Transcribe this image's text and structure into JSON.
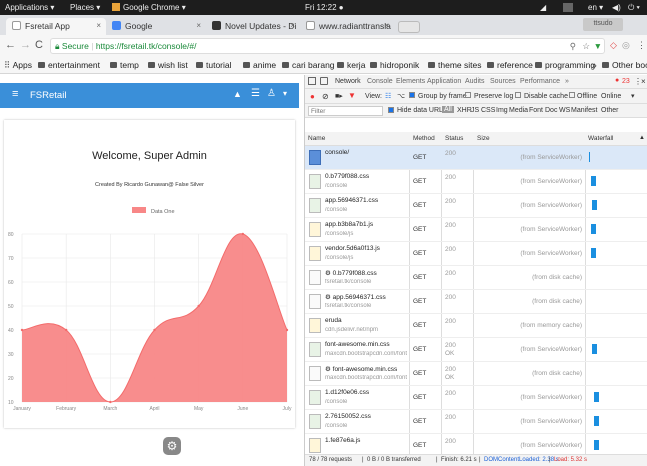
{
  "topbar": {
    "applications": "Applications ▾",
    "places": "Places ▾",
    "chrome": "Google Chrome ▾",
    "clock": "Fri 12:22 ●",
    "lang": "en ▾"
  },
  "tabs": [
    {
      "label": "Fsretail App",
      "close": "×",
      "color": "#3a8fd9"
    },
    {
      "label": "Google",
      "close": "×",
      "color": "#ffffff"
    },
    {
      "label": "Novel Updates - Di",
      "close": "×",
      "color": "#333333"
    },
    {
      "label": "www.radianttransla",
      "close": "×",
      "color": "#ffffff"
    }
  ],
  "profile": "ttsudo",
  "address": {
    "secure": "Secure",
    "url": "https://fsretail.tk/console/#/"
  },
  "bookmarks": [
    "Apps",
    "entertainment",
    "temp",
    "wish list",
    "tutorial",
    "anime",
    "cari barang",
    "kerja",
    "hidroponik",
    "theme sites",
    "reference",
    "programming"
  ],
  "bookmarks_more": "»",
  "bookmarks_other": "Other bookmarks",
  "app": {
    "title": "FSRetail",
    "welcome": "Welcome, Super Admin",
    "credit": "Created By Ricardo Gunawan@ False Silver"
  },
  "chart_data": {
    "type": "area",
    "title": "",
    "legend": "Data One",
    "categories": [
      "January",
      "February",
      "March",
      "April",
      "May",
      "June",
      "July"
    ],
    "values": [
      40,
      40,
      10,
      40,
      50,
      80,
      40
    ],
    "yticks": [
      10,
      20,
      30,
      40,
      50,
      60,
      70,
      80
    ],
    "ylim": [
      10,
      80
    ],
    "color": "#f88787"
  },
  "devtools": {
    "tabs": [
      "Network",
      "Console",
      "Elements",
      "Application",
      "Audits",
      "Sources",
      "Performance",
      "»"
    ],
    "errors": "23",
    "toolbar": {
      "view": "View:",
      "group": "Group by frame",
      "preserve": "Preserve log",
      "disable": "Disable cache",
      "offline": "Offline",
      "online": "Online"
    },
    "filter": {
      "placeholder": "Filter",
      "hide": "Hide data URLs",
      "types": [
        "All",
        "XHR",
        "JS",
        "CSS",
        "Img",
        "Media",
        "Font",
        "Doc",
        "WS",
        "Manifest",
        "Other"
      ]
    },
    "columns": {
      "name": "Name",
      "method": "Method",
      "status": "Status",
      "size": "Size",
      "waterfall": "Waterfall"
    },
    "rows": [
      {
        "name": "console/",
        "path": "",
        "method": "GET",
        "status": "200",
        "size": "(from ServiceWorker)"
      },
      {
        "name": "0.b779f088.css",
        "path": "/console",
        "method": "GET",
        "status": "200",
        "size": "(from ServiceWorker)"
      },
      {
        "name": "app.56946371.css",
        "path": "/console",
        "method": "GET",
        "status": "200",
        "size": "(from ServiceWorker)"
      },
      {
        "name": "app.b3b8a7b1.js",
        "path": "/console/js",
        "method": "GET",
        "status": "200",
        "size": "(from ServiceWorker)"
      },
      {
        "name": "vendor.5d6a0f13.js",
        "path": "/console/js",
        "method": "GET",
        "status": "200",
        "size": "(from ServiceWorker)"
      },
      {
        "name": "⚙ 0.b779f088.css",
        "path": "fsretail.tk/console",
        "method": "GET",
        "status": "200",
        "size": "(from disk cache)"
      },
      {
        "name": "⚙ app.56946371.css",
        "path": "fsretail.tk/console",
        "method": "GET",
        "status": "200",
        "size": "(from disk cache)"
      },
      {
        "name": "eruda",
        "path": "cdn.jsdelivr.net/npm",
        "method": "GET",
        "status": "200",
        "size": "(from memory cache)"
      },
      {
        "name": "font-awesome.min.css",
        "path": "maxcdn.bootstrapcdn.com/font...",
        "method": "GET",
        "status": "200\nOK",
        "size": "(from ServiceWorker)"
      },
      {
        "name": "⚙ font-awesome.min.css",
        "path": "maxcdn.bootstrapcdn.com/font...",
        "method": "GET",
        "status": "200\nOK",
        "size": "(from disk cache)"
      },
      {
        "name": "1.d12f0e06.css",
        "path": "/console",
        "method": "GET",
        "status": "200",
        "size": "(from ServiceWorker)"
      },
      {
        "name": "2.76150052.css",
        "path": "/console",
        "method": "GET",
        "status": "200",
        "size": "(from ServiceWorker)"
      },
      {
        "name": "1.fe87e6a.js",
        "path": "",
        "method": "GET",
        "status": "200",
        "size": "(from ServiceWorker)"
      }
    ],
    "statusbar": {
      "requests": "78 / 78 requests",
      "transferred": "0 B / 0 B transferred",
      "finish": "Finish: 6.21 s",
      "dcl": "DOMContentLoaded: 2.38 s",
      "load": "Load: 5.32 s"
    }
  }
}
